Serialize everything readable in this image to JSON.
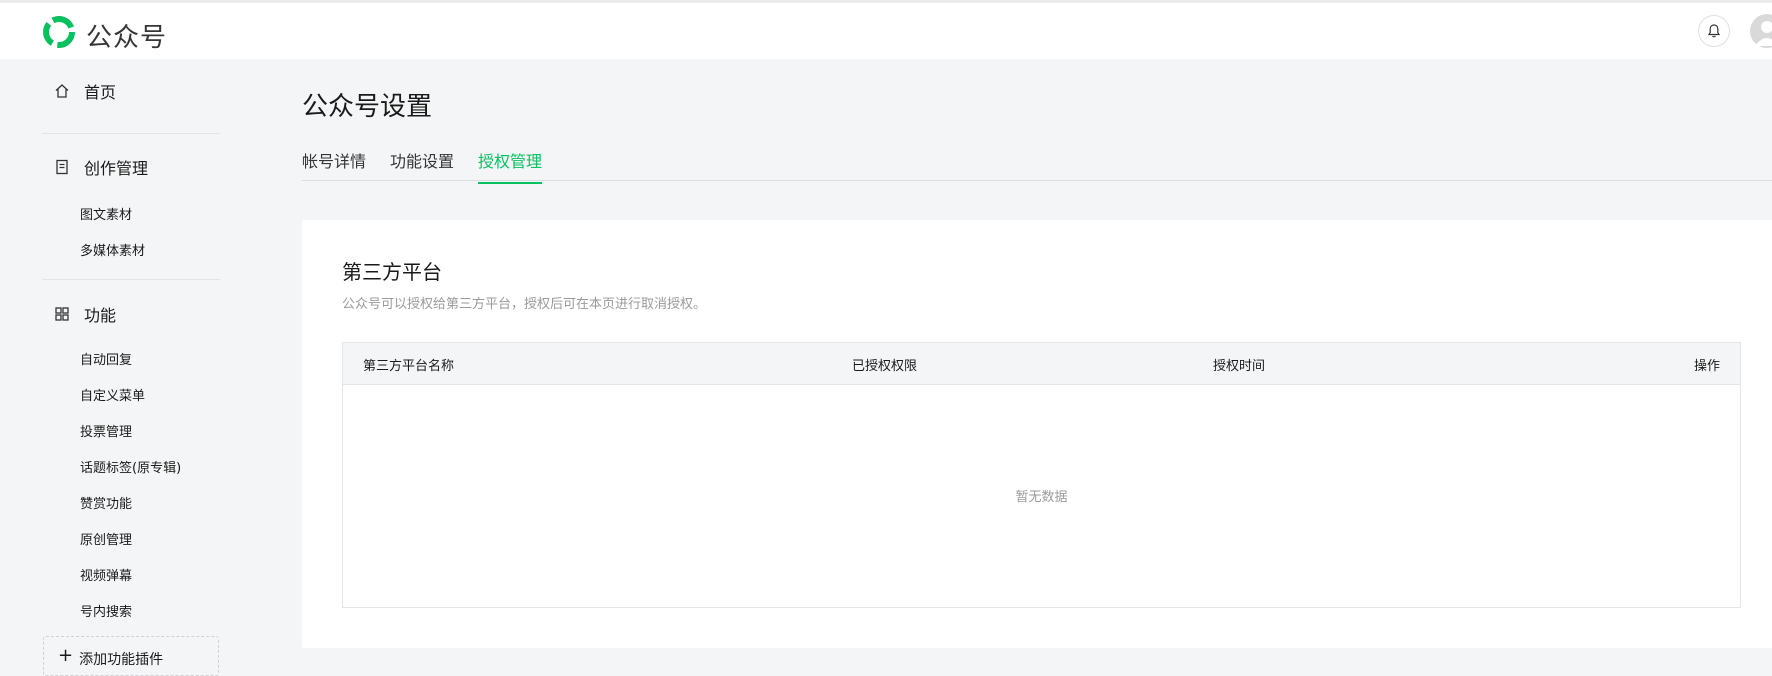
{
  "header": {
    "brand": "公众号",
    "colors": {
      "accent": "#07c160"
    },
    "icons": {
      "logo": "wechat-official-account-logo",
      "bell": "bell-icon",
      "avatar": "user-avatar-icon"
    }
  },
  "sidebar": {
    "home": {
      "label": "首页",
      "icon": "home-icon"
    },
    "creation": {
      "label": "创作管理",
      "icon": "document-icon",
      "items": [
        "图文素材",
        "多媒体素材"
      ]
    },
    "features": {
      "label": "功能",
      "icon": "grid-icon",
      "items": [
        "自动回复",
        "自定义菜单",
        "投票管理",
        "话题标签(原专辑)",
        "赞赏功能",
        "原创管理",
        "视频弹幕",
        "号内搜索"
      ]
    },
    "add_plugin": "添加功能插件"
  },
  "main": {
    "title": "公众号设置",
    "tabs": [
      {
        "label": "帐号详情",
        "active": false
      },
      {
        "label": "功能设置",
        "active": false
      },
      {
        "label": "授权管理",
        "active": true
      }
    ],
    "section": {
      "title": "第三方平台",
      "description": "公众号可以授权给第三方平台，授权后可在本页进行取消授权。",
      "table": {
        "columns": [
          "第三方平台名称",
          "已授权权限",
          "授权时间",
          "操作"
        ],
        "rows": [],
        "empty_text": "暂无数据"
      }
    }
  }
}
